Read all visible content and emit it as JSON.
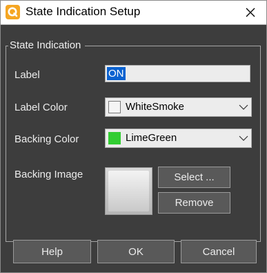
{
  "window": {
    "title": "State Indication Setup"
  },
  "group": {
    "title": "State Indication",
    "label_caption": "Label",
    "label_value": "ON",
    "label_color_caption": "Label Color",
    "label_color": {
      "name": "WhiteSmoke",
      "hex": "#f5f5f5"
    },
    "backing_color_caption": "Backing Color",
    "backing_color": {
      "name": "LimeGreen",
      "hex": "#32cd32"
    },
    "backing_image_caption": "Backing Image",
    "select_label": "Select ...",
    "remove_label": "Remove"
  },
  "footer": {
    "help_label": "Help",
    "ok_label": "OK",
    "cancel_label": "Cancel"
  },
  "icons": {
    "app": "app-logo-icon",
    "close": "close-icon",
    "dropdown": "chevron-down-icon"
  },
  "colors": {
    "app_icon": "#f5a623",
    "dialog_bg": "#3d3d3d",
    "button_bg": "#595959",
    "selection": "#0a62d0"
  }
}
